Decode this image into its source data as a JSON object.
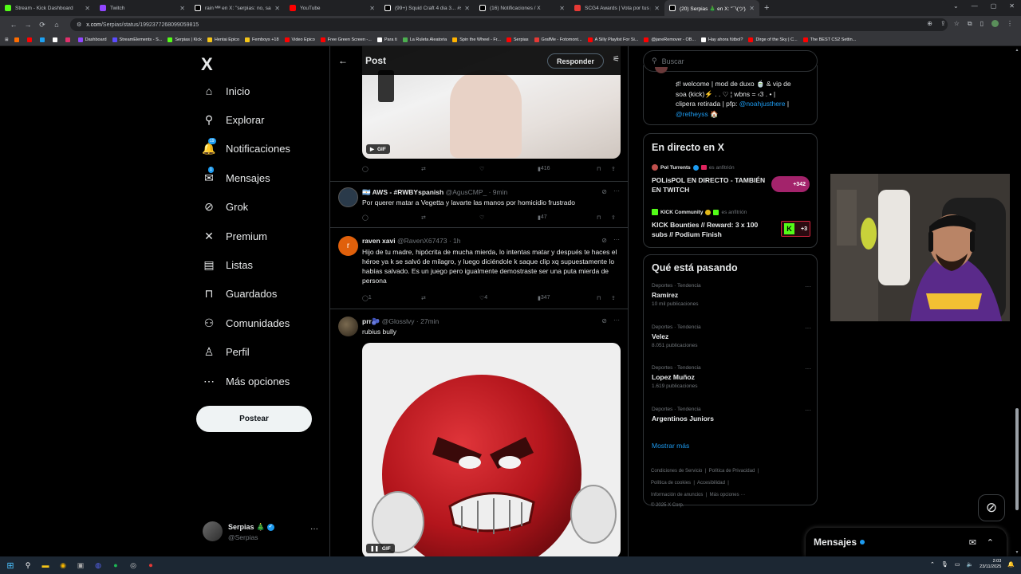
{
  "browser": {
    "tabs": [
      {
        "title": "Stream - Kick Dashboard",
        "icon": "kick-icon",
        "color": "#53fc18"
      },
      {
        "title": "Twitch",
        "icon": "twitch-icon",
        "color": "#9146ff"
      },
      {
        "title": "rain ᴹᴹ en X: \"serpias: no, sapn",
        "icon": "x-icon",
        "color": "#ffffff"
      },
      {
        "title": "YouTube",
        "icon": "youtube-icon",
        "color": "#ff0000"
      },
      {
        "title": "(99+) Squid Craft 4 dia 3... #squ",
        "icon": "tiktok-icon",
        "color": "#ffffff"
      },
      {
        "title": "(16) Notificaciones / X",
        "icon": "x-icon",
        "color": "#ffffff"
      },
      {
        "title": "SCG4 Awards | Vota por tus pe",
        "icon": "awards-icon",
        "color": "#e53935"
      },
      {
        "title": "(20) Serpias 🎄 en X: \"¯\\(ツ)/¯ / X",
        "icon": "x-icon",
        "color": "#ffffff",
        "active": true
      }
    ],
    "new_tab": "+",
    "url_prefix": "x.com",
    "url_path": "/Serpias/status/1992377268099059815",
    "bookmarks": [
      {
        "label": "",
        "color": "#ff6d00"
      },
      {
        "label": "",
        "color": "#ff0000"
      },
      {
        "label": "",
        "color": "#1da1f2"
      },
      {
        "label": "",
        "color": "#ffffff"
      },
      {
        "label": "",
        "color": "#e1306c"
      },
      {
        "label": "Dashboard",
        "color": "#9146ff"
      },
      {
        "label": "StreamElements - S...",
        "color": "#5b4cff"
      },
      {
        "label": "Serpias | Kick",
        "color": "#53fc18"
      },
      {
        "label": "Hentai Epico",
        "color": "#f5c518"
      },
      {
        "label": "Femboys +18",
        "color": "#f5c518"
      },
      {
        "label": "Video Epico",
        "color": "#ff0000"
      },
      {
        "label": "Free Green Screen -...",
        "color": "#ff0000"
      },
      {
        "label": "Para ti",
        "color": "#ffffff"
      },
      {
        "label": "La Ruleta Aleatoria",
        "color": "#4caf50"
      },
      {
        "label": "Spin the Wheel - Fr...",
        "color": "#ffb300"
      },
      {
        "label": "Serpias",
        "color": "#ff0000"
      },
      {
        "label": "GrafMe - Fotomont...",
        "color": "#e53935"
      },
      {
        "label": "A Silly Playlist For Si...",
        "color": "#ff0000"
      },
      {
        "label": "@janeRemover - OB...",
        "color": "#ff0000"
      },
      {
        "label": "Hay ahora fútbol?",
        "color": "#ffffff"
      },
      {
        "label": "Dirge of the Sky | C...",
        "color": "#ff0000"
      },
      {
        "label": "The BEST CS2 Settin...",
        "color": "#ff0000"
      }
    ]
  },
  "sidebar": {
    "logo": "X",
    "items": [
      {
        "label": "Inicio",
        "icon": "home-icon"
      },
      {
        "label": "Explorar",
        "icon": "search-icon"
      },
      {
        "label": "Notificaciones",
        "icon": "bell-icon",
        "badge": "19"
      },
      {
        "label": "Mensajes",
        "icon": "mail-icon",
        "badge": "1"
      },
      {
        "label": "Grok",
        "icon": "grok-icon"
      },
      {
        "label": "Premium",
        "icon": "x-premium-icon"
      },
      {
        "label": "Listas",
        "icon": "list-icon"
      },
      {
        "label": "Guardados",
        "icon": "bookmark-icon"
      },
      {
        "label": "Comunidades",
        "icon": "people-icon"
      },
      {
        "label": "Perfil",
        "icon": "person-icon"
      },
      {
        "label": "Más opciones",
        "icon": "more-circle-icon"
      }
    ],
    "post_button": "Postear",
    "account": {
      "name": "Serpias 🎄",
      "handle": "@Serpias",
      "more": "···"
    }
  },
  "post_header": {
    "title": "Post",
    "reply_button": "Responder"
  },
  "top_tweet_actions": {
    "views": "416"
  },
  "gif_label": "GIF",
  "tweets": [
    {
      "name": "🇦🇷 AWS - #RWBYspanish",
      "handle": "@AgusCMP_",
      "time": "· 9min",
      "text": "Por querer matar a Vegetta y lavarte las manos por homicidio frustrado",
      "replies": "",
      "likes": "",
      "views": "47",
      "avatar_color": "#2a3a4a"
    },
    {
      "name": "raven xavi",
      "handle": "@RavenX67473",
      "time": "· 1h",
      "text": "Hijo de tu madre, hipócrita de mucha mierda, lo intentas matar y después te haces el héroe ya k se salvó de milagro, y luego diciéndole k saque clip xq supuestamente lo habías salvado. Es un juego pero igualmente demostraste ser una puta mierda de persona",
      "avatar_letter": "r",
      "replies": "1",
      "likes": "4",
      "views": "347",
      "avatar_color": "#e0600b"
    },
    {
      "name": "prr🫐",
      "handle": "@Glosslvy",
      "time": "· 27min",
      "text": "rubius bully",
      "avatar_color": "#4a3a2a"
    }
  ],
  "right": {
    "search_placeholder": "Buscar",
    "bio_card": {
      "line1": "♯! welcome | mod de duxo 🍵 & vip de",
      "line2": "soa (kick)⚡ . . ♡ ¦   wbns = ‹3 . • |",
      "line3a": "clipera retirada | pfp: ",
      "line3b": "@noahjusthere",
      "line3c": " |",
      "line4a": "@retheyss",
      "line4b": " 🏠"
    },
    "live": {
      "title": "En directo en X",
      "items": [
        {
          "host": "Pol Turrents",
          "host_suffix": "es anfitrión",
          "title": "POLisPOL EN DIRECTO - TAMBIÉN EN TWITCH",
          "count": "+342"
        },
        {
          "host": "KICK Community",
          "host_suffix": "es anfitrión",
          "title": "KICK Bounties // Reward: 3 x 100 subs // Podium Finish",
          "count": "+3"
        }
      ]
    },
    "trends": {
      "title": "Qué está pasando",
      "items": [
        {
          "category": "Deportes · Tendencia",
          "name": "Ramírez",
          "count": "10 mil publicaciones"
        },
        {
          "category": "Deportes · Tendencia",
          "name": "Velez",
          "count": "8.051 publicaciones"
        },
        {
          "category": "Deportes · Tendencia",
          "name": "Lopez Muñoz",
          "count": "1.619 publicaciones"
        },
        {
          "category": "Deportes · Tendencia",
          "name": "Argentinos Juniors",
          "count": ""
        }
      ],
      "more": "Mostrar más"
    },
    "footer": {
      "line1": [
        "Condiciones de Servicio",
        "Política de Privacidad"
      ],
      "line2": [
        "Política de cookies",
        "Accesibilidad"
      ],
      "line3": [
        "Información de anuncios",
        "Más opciones ···"
      ],
      "copyright": "© 2025 X Corp."
    }
  },
  "messages_drawer": {
    "title": "Mensajes"
  },
  "taskbar": {
    "time": "2:03",
    "date": "23/11/2025"
  },
  "colors": {
    "accent": "#1d9bf0",
    "bg": "#000000",
    "border": "#2f3336",
    "muted": "#71767b"
  }
}
